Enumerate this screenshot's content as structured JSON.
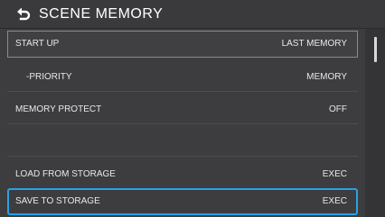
{
  "header": {
    "title": "SCENE MEMORY",
    "back_icon": "back-arrow-icon"
  },
  "menu": {
    "items": [
      {
        "label": "START UP",
        "value": "LAST MEMORY"
      },
      {
        "label": "-PRIORITY",
        "value": "MEMORY"
      },
      {
        "label": "MEMORY PROTECT",
        "value": "OFF"
      },
      {
        "label": "",
        "value": ""
      },
      {
        "label": "LOAD FROM STORAGE",
        "value": "EXEC"
      },
      {
        "label": "SAVE TO STORAGE",
        "value": "EXEC"
      }
    ],
    "selected_index": 0,
    "focused_index": 5
  },
  "colors": {
    "header_bg": "#3a3a3c",
    "list_bg": "#3d3d3f",
    "text": "#e8e8e8",
    "focus_border": "#2aa0e6",
    "selected_border": "#8c8c8e"
  }
}
